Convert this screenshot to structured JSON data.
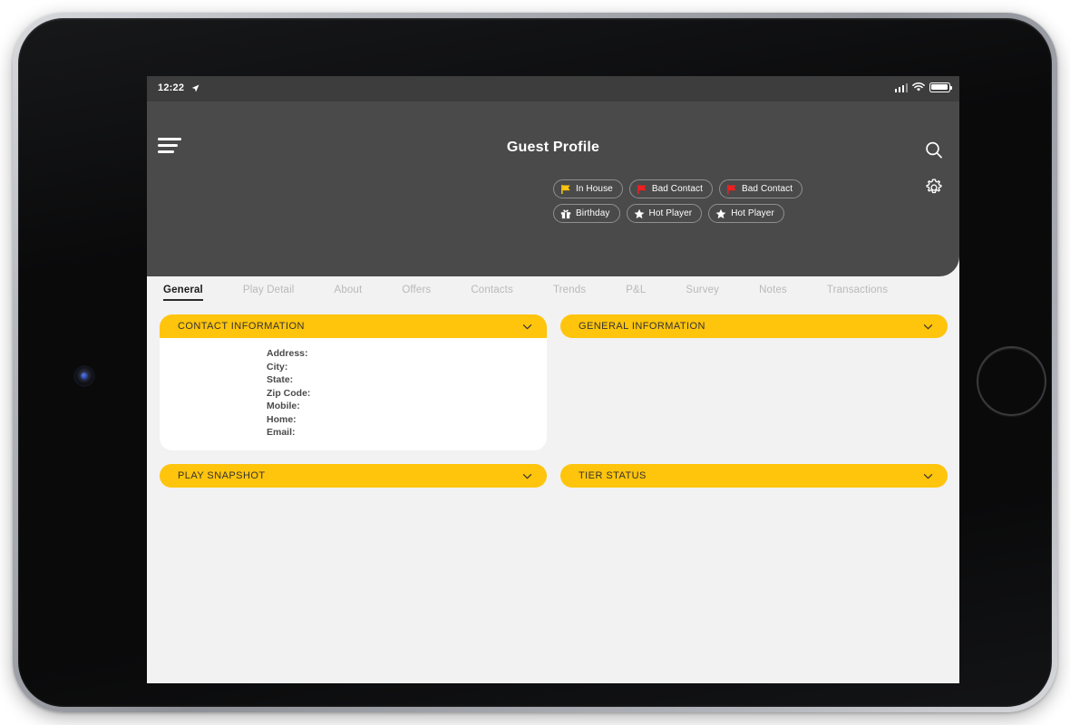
{
  "device": {
    "name": "tablet-device-frame",
    "home_button": "home-button",
    "camera": "front-camera"
  },
  "status_bar": {
    "time": "12:22",
    "location_icon": "location-arrow-icon",
    "signal_icon": "cellular-signal-icon",
    "wifi_icon": "wifi-icon",
    "battery_icon": "battery-icon"
  },
  "header": {
    "title": "Guest Profile",
    "menu_icon": "hamburger-menu-icon",
    "search_icon": "search-icon",
    "settings_icon": "gear-icon",
    "background": "#4a4a4a"
  },
  "badges": [
    {
      "label": "In House",
      "icon": "flag-icon",
      "icon_color": "#FFC40C"
    },
    {
      "label": "Bad Contact",
      "icon": "flag-icon",
      "icon_color": "#F01E20"
    },
    {
      "label": "Bad Contact",
      "icon": "flag-icon",
      "icon_color": "#F01E20"
    },
    {
      "label": "Birthday",
      "icon": "gift-icon",
      "icon_color": "#FFFFFF"
    },
    {
      "label": "Hot Player",
      "icon": "star-icon",
      "icon_color": "#FFFFFF"
    },
    {
      "label": "Hot Player",
      "icon": "star-icon",
      "icon_color": "#FFFFFF"
    }
  ],
  "tabs": [
    {
      "label": "General",
      "active": true
    },
    {
      "label": "Play Detail",
      "active": false
    },
    {
      "label": "About",
      "active": false
    },
    {
      "label": "Offers",
      "active": false
    },
    {
      "label": "Contacts",
      "active": false
    },
    {
      "label": "Trends",
      "active": false
    },
    {
      "label": "P&L",
      "active": false
    },
    {
      "label": "Survey",
      "active": false
    },
    {
      "label": "Notes",
      "active": false
    },
    {
      "label": "Transactions",
      "active": false
    }
  ],
  "panels": {
    "contact_information": {
      "title": "CONTACT INFORMATION",
      "expanded": true,
      "chevron_icon": "chevron-down-icon",
      "fields": [
        {
          "label": "Address:",
          "value": ""
        },
        {
          "label": "City:",
          "value": ""
        },
        {
          "label": "State:",
          "value": ""
        },
        {
          "label": "Zip Code:",
          "value": ""
        },
        {
          "label": "Mobile:",
          "value": ""
        },
        {
          "label": "Home:",
          "value": ""
        },
        {
          "label": "Email:",
          "value": ""
        }
      ]
    },
    "general_information": {
      "title": "GENERAL INFORMATION",
      "expanded": false,
      "chevron_icon": "chevron-down-icon"
    },
    "play_snapshot": {
      "title": "PLAY SNAPSHOT",
      "expanded": false,
      "chevron_icon": "chevron-down-icon"
    },
    "tier_status": {
      "title": "TIER STATUS",
      "expanded": false,
      "chevron_icon": "chevron-down-icon"
    }
  },
  "colors": {
    "accent_yellow": "#FFC40C",
    "header_grey": "#4a4a4a",
    "status_grey": "#3d3d3d",
    "content_bg": "#f2f2f2",
    "flag_red": "#F01E20"
  }
}
